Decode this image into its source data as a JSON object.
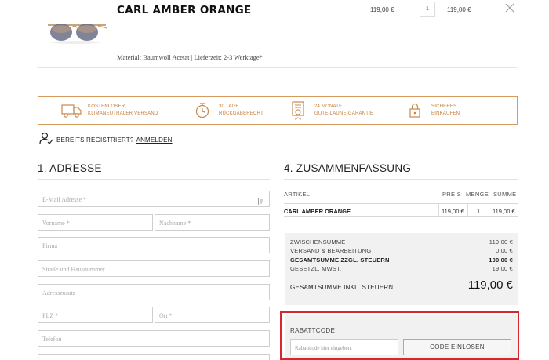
{
  "cart_item": {
    "name": "CARL AMBER ORANGE",
    "unit_price": "119,00 €",
    "quantity": "1",
    "line_total": "119,00 €",
    "meta": "Material: Baumwoll Acetat | Lieferzeit: 2-3 Werktage*"
  },
  "trust": [
    {
      "icon": "truck-icon",
      "line1": "KOSTENLOSER,",
      "line2": "KLIMANEUTRALER VERSAND"
    },
    {
      "icon": "return-icon",
      "line1": "30 TAGE",
      "line2": "RÜCKGABERECHT"
    },
    {
      "icon": "certificate-icon",
      "line1": "24 MONATE",
      "line2": "GUTE-LAUNE-GARANTIE"
    },
    {
      "icon": "lock-icon",
      "line1": "SICHERES",
      "line2": "EINKAUFEN"
    }
  ],
  "login": {
    "prompt": "BEREITS REGISTRIERT?",
    "link": "ANMELDEN"
  },
  "address": {
    "title": "1. ADRESSE",
    "email_ph": "E-Mail Adresse *",
    "vorname_ph": "Vorname *",
    "nachname_ph": "Nachname *",
    "firma_ph": "Firma",
    "street_ph": "Straße und Hausnummer",
    "zusatz_ph": "Adresszusatz",
    "plz_ph": "PLZ *",
    "ort_ph": "Ort *",
    "telefon_ph": "Telefon"
  },
  "summary": {
    "title": "4. ZUSAMMENFASSUNG",
    "headers": {
      "artikel": "ARTIKEL",
      "preis": "PREIS",
      "menge": "MENGE",
      "summe": "SUMME"
    },
    "row": {
      "name": "CARL AMBER ORANGE",
      "preis": "119,00 €",
      "menge": "1",
      "summe": "119,00 €"
    },
    "zwischensumme_label": "ZWISCHENSUMME",
    "zwischensumme": "119,00 €",
    "versand_label": "VERSAND & BEARBEITUNG",
    "versand": "0,00 €",
    "netto_label": "GESAMTSUMME ZZGL. STEUERN",
    "netto": "100,00 €",
    "mwst_label": "GESETZL. MWST.",
    "mwst": "19,00 €",
    "total_label": "GESAMTSUMME INKL. STEUERN",
    "total": "119,00 €"
  },
  "coupon": {
    "title": "RABATTCODE",
    "placeholder": "Rabattcode hier eingeben.",
    "button": "CODE EINLÖSEN"
  },
  "colors": {
    "accent": "#d69a5e",
    "highlight": "#d8262c"
  }
}
